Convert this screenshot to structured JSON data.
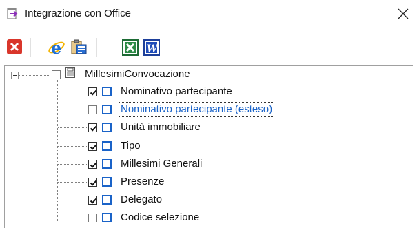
{
  "window": {
    "title": "Integrazione con Office",
    "close_icon": "close-icon",
    "title_icon": "export-arrow-icon"
  },
  "toolbar": {
    "buttons": [
      {
        "name": "close",
        "icon": "red-x-icon"
      },
      {
        "name": "internet-explorer",
        "icon": "internet-explorer-icon"
      },
      {
        "name": "copy-clipboard",
        "icon": "clipboard-copy-icon"
      },
      {
        "name": "excel",
        "icon": "excel-icon"
      },
      {
        "name": "word",
        "icon": "word-icon"
      }
    ]
  },
  "tree": {
    "root": {
      "label": "MillesimiConvocazione",
      "checked": false,
      "expanded": true
    },
    "items": [
      {
        "label": "Nominativo partecipante",
        "checked": true
      },
      {
        "label": "Nominativo partecipante (esteso)",
        "checked": false,
        "selected": true
      },
      {
        "label": "Unità immobiliare",
        "checked": true
      },
      {
        "label": "Tipo",
        "checked": true
      },
      {
        "label": "Millesimi Generali",
        "checked": true
      },
      {
        "label": "Presenze",
        "checked": true
      },
      {
        "label": "Delegato",
        "checked": true
      },
      {
        "label": "Codice selezione",
        "checked": false
      }
    ]
  },
  "colors": {
    "accent_blue": "#1a63c8",
    "selected_text": "#1a63c8"
  }
}
